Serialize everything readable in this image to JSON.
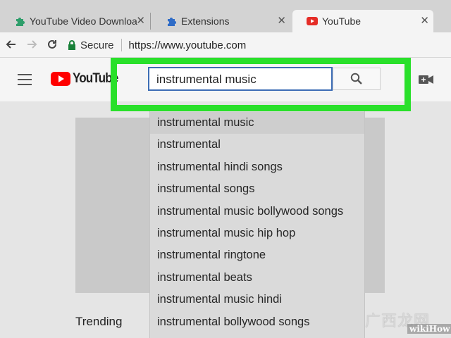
{
  "browser": {
    "tabs": [
      {
        "label": "YouTube Video Downloa",
        "icon": "puzzle-piece-icon",
        "active": false
      },
      {
        "label": "Extensions",
        "icon": "puzzle-piece-icon",
        "active": false
      },
      {
        "label": "YouTube",
        "icon": "youtube-icon",
        "active": true
      }
    ],
    "secure_label": "Secure",
    "url": "https://www.youtube.com"
  },
  "youtube": {
    "logo_text": "YouTube",
    "search": {
      "value": "instrumental music"
    },
    "suggestions": [
      "instrumental music",
      "instrumental",
      "instrumental hindi songs",
      "instrumental songs",
      "instrumental music bollywood songs",
      "instrumental music hip hop",
      "instrumental ringtone",
      "instrumental beats",
      "instrumental music hindi",
      "instrumental bollywood songs"
    ],
    "trending_label": "Trending"
  },
  "watermark": {
    "chinese": "广西龙网",
    "brand": "wikiHow"
  },
  "colors": {
    "highlight": "#29e02a",
    "youtube_red": "#ff0000",
    "search_border": "#3d6db5",
    "secure_green": "#188038"
  }
}
